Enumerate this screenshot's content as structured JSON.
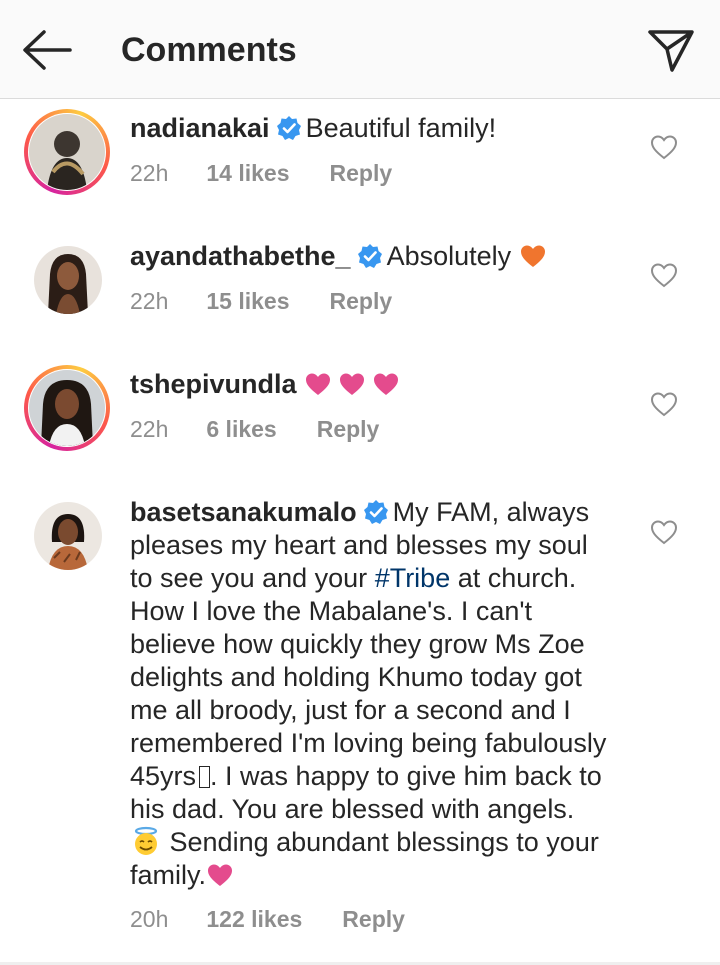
{
  "header": {
    "title": "Comments",
    "back_icon": "back-arrow-icon",
    "share_icon": "direct-send-icon"
  },
  "colors": {
    "verified_blue": "#3897f0",
    "orange_heart": "#f0752e",
    "pink_heart": "#e44b8d",
    "secondary_text": "#8e8e8e",
    "hashtag": "#003569"
  },
  "comments": [
    {
      "username": "nadianakai",
      "verified": true,
      "text": "Beautiful family!",
      "time": "22h",
      "likes": "14 likes",
      "reply": "Reply",
      "has_story_ring": true
    },
    {
      "username": "ayandathabethe_",
      "verified": true,
      "text": "Absolutely",
      "trailing_emoji": "orange-heart",
      "time": "22h",
      "likes": "15 likes",
      "reply": "Reply",
      "has_story_ring": false
    },
    {
      "username": "tshepivundla",
      "verified": false,
      "emoji": "pink-heart x3",
      "time": "22h",
      "likes": "6 likes",
      "reply": "Reply",
      "has_story_ring": true
    },
    {
      "username": "basetsanakumalo",
      "verified": true,
      "text_part1": "My FAM, always pleases my heart and blesses my soul to see you and your",
      "hashtag": "#Tribe",
      "text_part2": "at church. How I love the Mabalane's. I can't believe how quickly they grow Ms Zoe delights and holding Khumo today got me all broody, just for a second and I remembered I'm loving being fabulously 45yrs",
      "text_part3": ". I was happy to give him back to his dad. You are blessed with angels.",
      "text_part4": "Sending abundant blessings to your family.",
      "time": "20h",
      "likes": "122 likes",
      "reply": "Reply",
      "has_story_ring": false
    }
  ]
}
